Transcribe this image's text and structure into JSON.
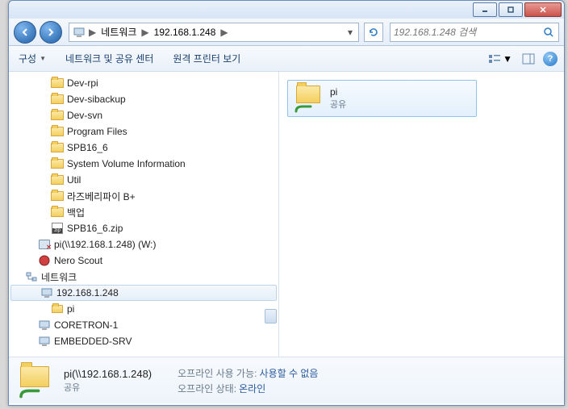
{
  "window": {
    "min": "minimize",
    "max": "maximize",
    "close": "close"
  },
  "nav": {
    "crumb1": "네트워크",
    "crumb2": "192.168.1.248",
    "search_placeholder": "192.168.1.248 검색"
  },
  "toolbar": {
    "organize": "구성",
    "net_center": "네트워크 및 공유 센터",
    "remote_printers": "원격 프린터 보기"
  },
  "tree": [
    {
      "indent": 52,
      "icon": "folder",
      "label": "Dev-rpi"
    },
    {
      "indent": 52,
      "icon": "folder",
      "label": "Dev-sibackup"
    },
    {
      "indent": 52,
      "icon": "folder",
      "label": "Dev-svn"
    },
    {
      "indent": 52,
      "icon": "folder",
      "label": "Program Files"
    },
    {
      "indent": 52,
      "icon": "folder",
      "label": "SPB16_6"
    },
    {
      "indent": 52,
      "icon": "folder",
      "label": "System Volume Information"
    },
    {
      "indent": 52,
      "icon": "folder",
      "label": "Util"
    },
    {
      "indent": 52,
      "icon": "folder",
      "label": "라즈베리파이 B+"
    },
    {
      "indent": 52,
      "icon": "folder",
      "label": "백업"
    },
    {
      "indent": 52,
      "icon": "zip",
      "label": "SPB16_6.zip"
    },
    {
      "indent": 36,
      "icon": "netdrive-disc",
      "label": "pi(\\\\192.168.1.248) (W:)"
    },
    {
      "indent": 36,
      "icon": "nero",
      "label": "Nero Scout"
    },
    {
      "indent": 20,
      "icon": "network",
      "label": "네트워크"
    },
    {
      "indent": 36,
      "icon": "computer",
      "label": "192.168.1.248",
      "selected": true
    },
    {
      "indent": 52,
      "icon": "share",
      "label": "pi"
    },
    {
      "indent": 36,
      "icon": "computer",
      "label": "CORETRON-1"
    },
    {
      "indent": 36,
      "icon": "computer",
      "label": "EMBEDDED-SRV"
    }
  ],
  "content_item": {
    "name": "pi",
    "subtitle": "공유"
  },
  "details": {
    "name": "pi(\\\\192.168.1.248)",
    "subtitle": "공유",
    "offline_avail_key": "오프라인 사용 가능:",
    "offline_avail_val": "사용할 수 없음",
    "offline_state_key": "오프라인 상태:",
    "offline_state_val": "온라인"
  }
}
